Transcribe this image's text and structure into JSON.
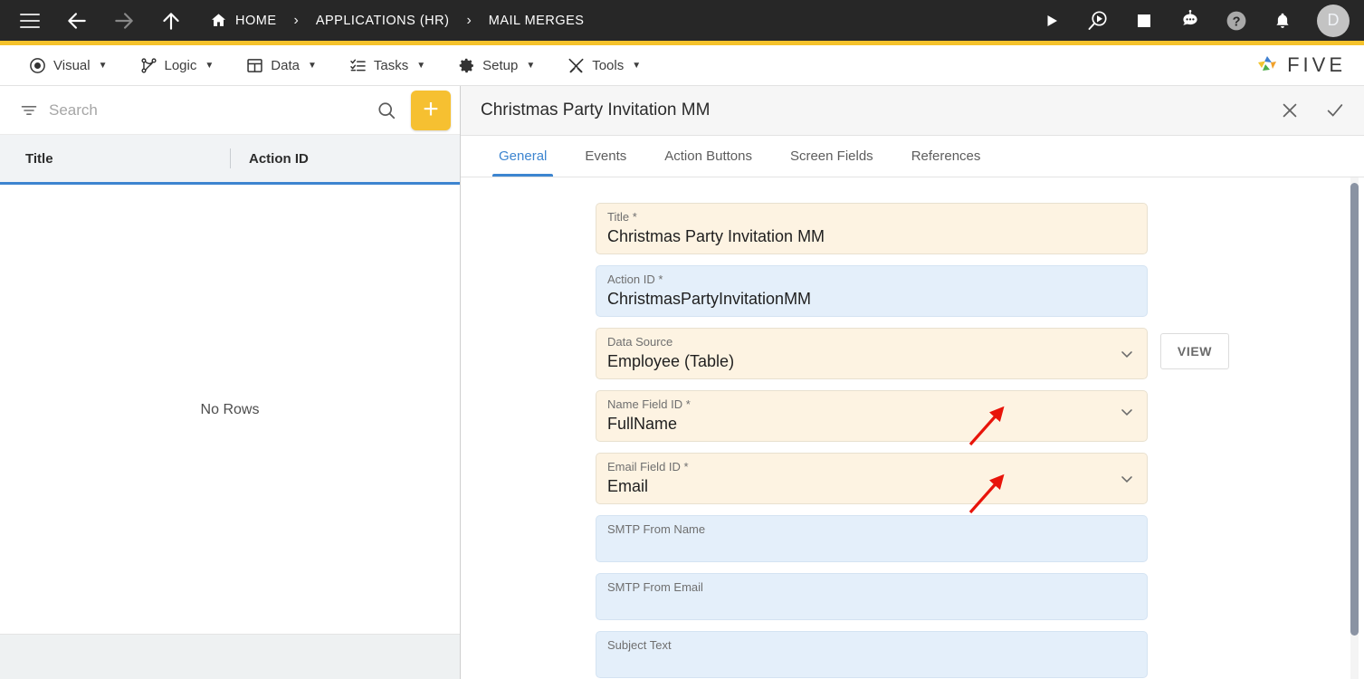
{
  "topbar": {
    "menu_icon": "hamburger-icon",
    "back_icon": "arrow-left-icon",
    "forward_icon": "arrow-right-icon",
    "up_icon": "arrow-up-icon",
    "breadcrumbs": [
      {
        "label": "HOME",
        "icon": "home-icon"
      },
      {
        "label": "APPLICATIONS (HR)",
        "icon": ""
      },
      {
        "label": "MAIL MERGES",
        "icon": ""
      }
    ],
    "separator": "›",
    "actions": [
      {
        "name": "run-icon",
        "glyph": "▶"
      },
      {
        "name": "preview-debug-icon",
        "glyph": ""
      },
      {
        "name": "stop-icon",
        "glyph": "■"
      },
      {
        "name": "bot-icon",
        "glyph": ""
      },
      {
        "name": "help-icon",
        "glyph": "?"
      },
      {
        "name": "bell-icon",
        "glyph": ""
      }
    ],
    "avatar_initial": "D",
    "accent_color": "#f5c22b"
  },
  "menubar": {
    "items": [
      {
        "label": "Visual",
        "icon": "eye-icon"
      },
      {
        "label": "Logic",
        "icon": "logic-graph-icon"
      },
      {
        "label": "Data",
        "icon": "table-icon"
      },
      {
        "label": "Tasks",
        "icon": "task-list-icon"
      },
      {
        "label": "Setup",
        "icon": "gear-icon"
      },
      {
        "label": "Tools",
        "icon": "tools-icon"
      }
    ],
    "caret": "▼",
    "logo_text": "FIVE"
  },
  "left_panel": {
    "search": {
      "placeholder": "Search",
      "value": ""
    },
    "filter_icon": "filter-icon",
    "search_icon": "search-icon",
    "add_button_label": "+",
    "columns": [
      "Title",
      "Action ID"
    ],
    "empty_message": "No Rows",
    "rows": []
  },
  "record_panel": {
    "title": "Christmas Party Invitation MM",
    "close_label": "✕",
    "confirm_label": "✓",
    "tabs": [
      {
        "label": "General",
        "active": true
      },
      {
        "label": "Events",
        "active": false
      },
      {
        "label": "Action Buttons",
        "active": false
      },
      {
        "label": "Screen Fields",
        "active": false
      },
      {
        "label": "References",
        "active": false
      }
    ],
    "fields": [
      {
        "label": "Title *",
        "value": "Christmas Party Invitation MM",
        "style": "cream",
        "dropdown": false,
        "button": "",
        "arrow": false
      },
      {
        "label": "Action ID *",
        "value": "ChristmasPartyInvitationMM",
        "style": "blue",
        "dropdown": false,
        "button": "",
        "arrow": false
      },
      {
        "label": "Data Source",
        "value": "Employee (Table)",
        "style": "cream",
        "dropdown": true,
        "button": "VIEW",
        "arrow": false
      },
      {
        "label": "Name Field ID *",
        "value": "FullName",
        "style": "cream",
        "dropdown": true,
        "button": "",
        "arrow": true
      },
      {
        "label": "Email Field ID *",
        "value": "Email",
        "style": "cream",
        "dropdown": true,
        "button": "",
        "arrow": true
      },
      {
        "label": "SMTP From Name",
        "value": "",
        "style": "blue",
        "dropdown": false,
        "button": "",
        "arrow": false
      },
      {
        "label": "SMTP From Email",
        "value": "",
        "style": "blue",
        "dropdown": false,
        "button": "",
        "arrow": false
      },
      {
        "label": "Subject Text",
        "value": "",
        "style": "blue",
        "dropdown": false,
        "button": "",
        "arrow": false
      }
    ]
  },
  "colors": {
    "header_bg": "#272727",
    "accent_yellow": "#f5c22b",
    "tab_blue": "#3d85d0",
    "field_cream": "#fdf3e2",
    "field_blue": "#e4effa",
    "annotation_red": "#e8140a"
  }
}
